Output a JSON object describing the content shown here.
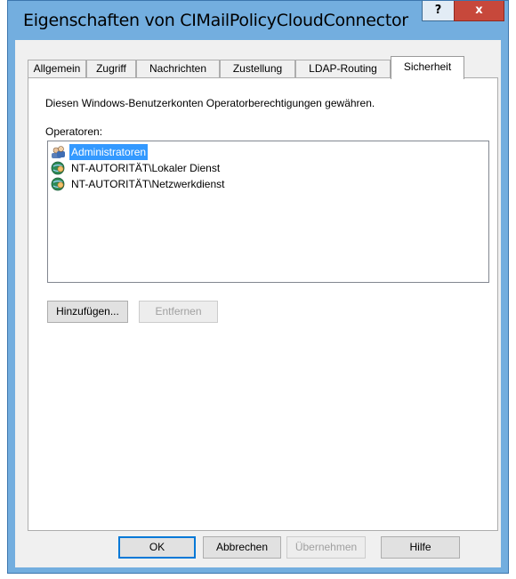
{
  "window": {
    "title": "Eigenschaften von CIMailPolicyCloudConnector",
    "help_label": "?",
    "close_label": "x"
  },
  "tabs": [
    {
      "label": "Allgemein"
    },
    {
      "label": "Zugriff"
    },
    {
      "label": "Nachrichten"
    },
    {
      "label": "Zustellung"
    },
    {
      "label": "LDAP-Routing"
    },
    {
      "label": "Sicherheit",
      "active": true
    }
  ],
  "security": {
    "description": "Diesen Windows-Benutzerkonten Operatorberechtigungen gewähren.",
    "operators_label": "Operatoren:",
    "operators": [
      {
        "name": "Administratoren",
        "icon": "users-group-icon",
        "selected": true
      },
      {
        "name": "NT-AUTORITÄT\\Lokaler Dienst",
        "icon": "globe-user-icon"
      },
      {
        "name": "NT-AUTORITÄT\\Netzwerkdienst",
        "icon": "globe-user-icon"
      }
    ],
    "add_label": "Hinzufügen...",
    "remove_label": "Entfernen"
  },
  "footer": {
    "ok_label": "OK",
    "cancel_label": "Abbrechen",
    "apply_label": "Übernehmen",
    "help_label": "Hilfe"
  }
}
